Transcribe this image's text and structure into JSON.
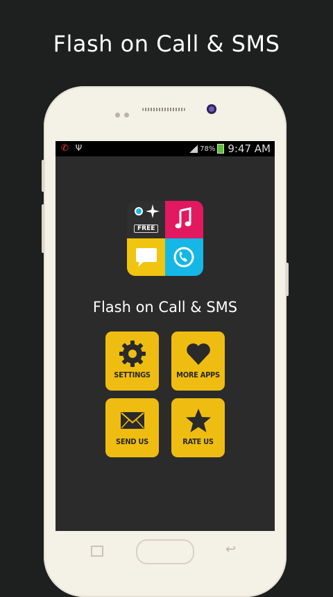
{
  "promo": {
    "title": "Flash on Call & SMS"
  },
  "status_bar": {
    "battery_percent": "78%",
    "time": "9:47 AM",
    "icons": [
      "missed-call-icon",
      "usb-icon",
      "signal-icon",
      "battery-icon"
    ]
  },
  "app": {
    "logo_badge": "FREE",
    "title": "Flash on Call & SMS",
    "tiles": [
      {
        "label": "SETTINGS",
        "icon": "gear-icon"
      },
      {
        "label": "MORE APPS",
        "icon": "heart-icon"
      },
      {
        "label": "SEND US",
        "icon": "envelope-icon"
      },
      {
        "label": "RATE US",
        "icon": "star-icon"
      }
    ]
  },
  "colors": {
    "background": "#1e1f1f",
    "tile": "#efbd12",
    "logo_pink": "#e2195f",
    "logo_yellow": "#f1c40f",
    "logo_cyan": "#14b7e6",
    "logo_dark": "#2f2f2f"
  }
}
